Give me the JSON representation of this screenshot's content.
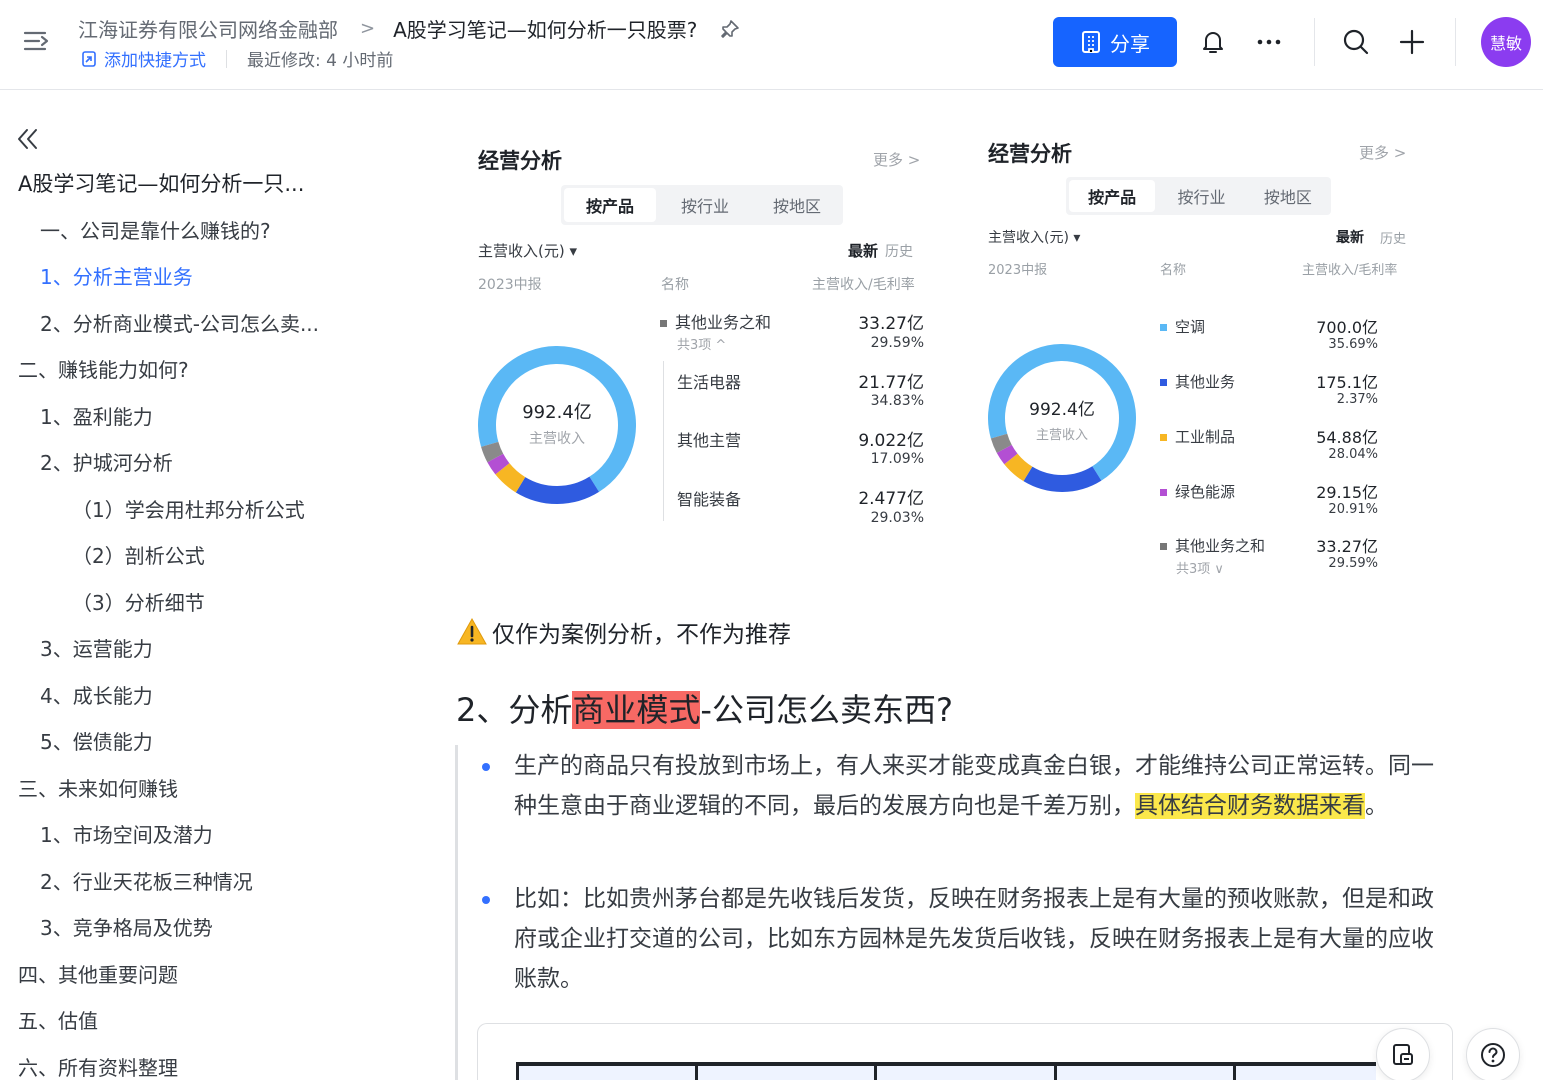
{
  "header": {
    "breadcrumb_parent": "江海证券有限公司网络金融部",
    "breadcrumb_sep": ">",
    "doc_title": "A股学习笔记—如何分析一只股票?",
    "add_shortcut": "添加快捷方式",
    "last_modified": "最近修改: 4 小时前",
    "share_label": "分享",
    "avatar_text": "慧敏",
    "colors": {
      "share": "#1664ff",
      "avatar": "#8b3cf0",
      "link": "#3370ff"
    }
  },
  "toc": {
    "items": [
      {
        "label": "A股学习笔记—如何分析一只...",
        "level": 0
      },
      {
        "label": "一、公司是靠什么赚钱的?",
        "level": 1
      },
      {
        "label": "1、分析主营业务",
        "level": 1
      },
      {
        "label": "2、分析商业模式-公司怎么卖...",
        "level": 1
      },
      {
        "label": "二、赚钱能力如何?",
        "level": 0
      },
      {
        "label": "1、盈利能力",
        "level": 1
      },
      {
        "label": "2、护城河分析",
        "level": 1
      },
      {
        "label": "（1）学会用杜邦分析公式",
        "level": 2
      },
      {
        "label": "（2）剖析公式",
        "level": 2
      },
      {
        "label": "（3）分析细节",
        "level": 2
      },
      {
        "label": "3、运营能力",
        "level": 1
      },
      {
        "label": "4、成长能力",
        "level": 1
      },
      {
        "label": "5、偿债能力",
        "level": 1
      },
      {
        "label": "三、未来如何赚钱",
        "level": 0
      },
      {
        "label": "1、市场空间及潜力",
        "level": 1
      },
      {
        "label": "2、行业天花板三种情况",
        "level": 1
      },
      {
        "label": "3、竞争格局及优势",
        "level": 1
      },
      {
        "label": "四、其他重要问题",
        "level": 0
      },
      {
        "label": "五、估值",
        "level": 0
      },
      {
        "label": "六、所有资料整理",
        "level": 0
      }
    ]
  },
  "card_left": {
    "title": "经营分析",
    "more": "更多 >",
    "tabs": [
      "按产品",
      "按行业",
      "按地区"
    ],
    "metric": "主营收入(元) ▾",
    "latest": "最新",
    "history": "历史",
    "period": "2023中报",
    "col_name": "名称",
    "col_value": "主营收入/毛利率",
    "center_value": "992.4亿",
    "center_label": "主营收入",
    "rows": [
      {
        "name": "其他业务之和",
        "sub": "共3项 ^",
        "value": "33.27亿",
        "pct": "29.59%"
      },
      {
        "name": "生活电器",
        "value": "21.77亿",
        "pct": "34.83%"
      },
      {
        "name": "其他主营",
        "value": "9.022亿",
        "pct": "17.09%"
      },
      {
        "name": "智能装备",
        "value": "2.477亿",
        "pct": "29.03%"
      }
    ]
  },
  "card_right": {
    "title": "经营分析",
    "more": "更多 >",
    "tabs": [
      "按产品",
      "按行业",
      "按地区"
    ],
    "metric": "主营收入(元) ▾",
    "latest": "最新",
    "history": "历史",
    "period": "2023中报",
    "col_name": "名称",
    "col_value": "主营收入/毛利率",
    "center_value": "992.4亿",
    "center_label": "主营收入",
    "rows": [
      {
        "name": "空调",
        "value": "700.0亿",
        "pct": "35.69%",
        "color": "#5ab8f5"
      },
      {
        "name": "其他业务",
        "value": "175.1亿",
        "pct": "2.37%",
        "color": "#2f5be0"
      },
      {
        "name": "工业制品",
        "value": "54.88亿",
        "pct": "28.04%",
        "color": "#f7b623"
      },
      {
        "name": "绿色能源",
        "value": "29.15亿",
        "pct": "20.91%",
        "color": "#b34fd3"
      },
      {
        "name": "其他业务之和",
        "sub": "共3项 ∨",
        "value": "33.27亿",
        "pct": "29.59%",
        "color": "#777777"
      }
    ]
  },
  "chart_data": [
    {
      "type": "pie",
      "categories": [
        "空调",
        "其他业务",
        "工业制品",
        "绿色能源",
        "其他业务之和"
      ],
      "values": [
        700.0,
        175.1,
        54.88,
        29.15,
        33.27
      ],
      "colors": [
        "#5ab8f5",
        "#2f5be0",
        "#f7b623",
        "#b34fd3",
        "#8a8a8a"
      ]
    },
    {
      "type": "pie",
      "categories": [
        "空调",
        "其他业务",
        "工业制品",
        "绿色能源",
        "其他业务之和"
      ],
      "values": [
        700.0,
        175.1,
        54.88,
        29.15,
        33.27
      ],
      "colors": [
        "#5ab8f5",
        "#2f5be0",
        "#f7b623",
        "#b34fd3",
        "#8a8a8a"
      ]
    }
  ],
  "content": {
    "warning": "仅作为案例分析，不作为推荐",
    "heading_prefix": "2、分析",
    "heading_highlight": "商业模式",
    "heading_suffix": "-公司怎么卖东西?",
    "bullet1_a": "生产的商品只有投放到市场上，有人来买才能变成真金白银，才能维持公司正常运转。同一种生意由于商业逻辑的不同，最后的发展方向也是千差万别，",
    "bullet1_highlight": "具体结合财务数据来看",
    "bullet1_end": "。",
    "bullet2": "比如：比如贵州茅台都是先收钱后发货，反映在财务报表上是有大量的预收账款，但是和政府或企业打交道的公司，比如东方园林是先发货后收钱，反映在财务报表上是有大量的应收账款。",
    "colors": {
      "highlight_red": "#f76964",
      "highlight_yellow": "#fbe84b",
      "bullet": "#3370ff"
    }
  }
}
